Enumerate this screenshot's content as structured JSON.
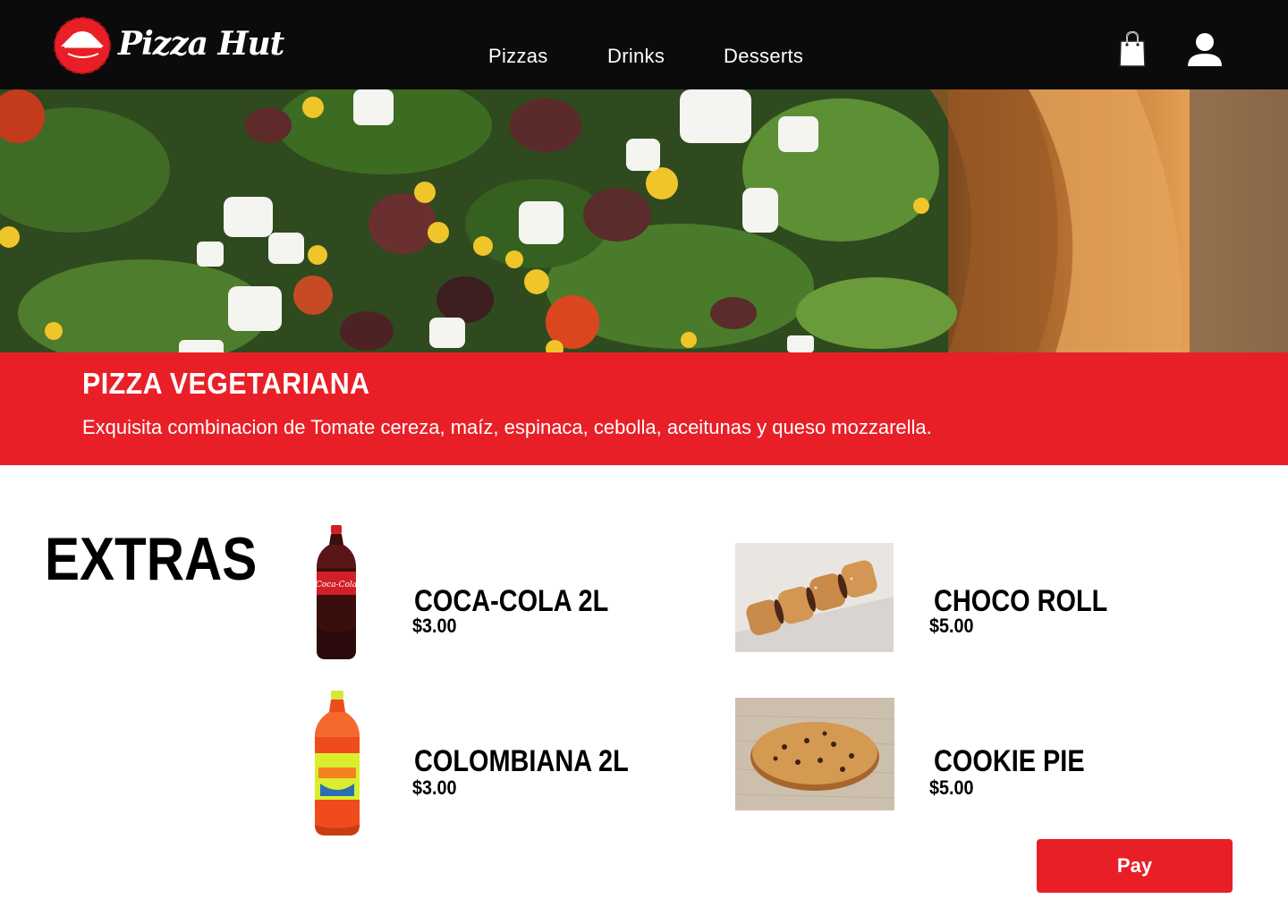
{
  "brand": {
    "name": "Pizza Hut",
    "accent": "#e91f27",
    "header_bg": "#0b0b0b"
  },
  "nav": {
    "items": [
      {
        "label": "Pizzas"
      },
      {
        "label": "Drinks"
      },
      {
        "label": "Desserts"
      }
    ]
  },
  "header_icons": {
    "cart": "shopping-bag-icon",
    "account": "user-icon"
  },
  "hero": {
    "image": "vegetarian-pizza-closeup"
  },
  "product": {
    "title": "PIZZA VEGETARIANA",
    "description": "Exquisita combinacion de Tomate cereza, maíz, espinaca, cebolla, aceitunas y queso mozzarella."
  },
  "extras": {
    "title": "EXTRAS",
    "items": [
      {
        "name": "COCA-COLA 2L",
        "price": "$3.00",
        "image": "coca-cola-bottle"
      },
      {
        "name": "CHOCO ROLL",
        "price": "$5.00",
        "image": "choco-roll"
      },
      {
        "name": "COLOMBIANA 2L",
        "price": "$3.00",
        "image": "colombiana-bottle"
      },
      {
        "name": "COOKIE PIE",
        "price": "$5.00",
        "image": "cookie-pie"
      }
    ]
  },
  "actions": {
    "pay_label": "Pay"
  }
}
